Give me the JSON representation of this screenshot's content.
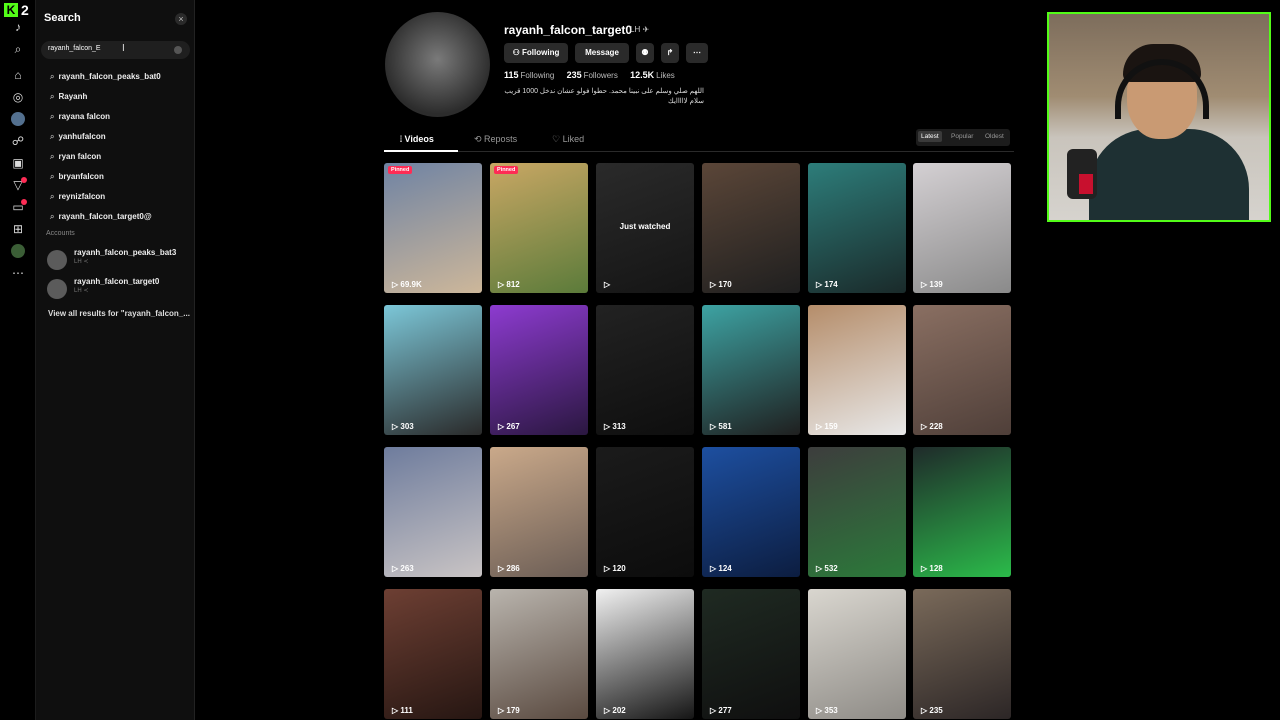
{
  "rail": {
    "brand_letter": "K",
    "viewer_count": "2",
    "icons": [
      "tiktok-logo-icon",
      "search-icon",
      "home-icon",
      "explore-icon",
      "live-icon",
      "following-icon",
      "upload-icon",
      "activity-icon",
      "messages-icon",
      "add-icon",
      "profile-icon",
      "more-icon"
    ]
  },
  "search": {
    "title": "Search",
    "close_label": "×",
    "query": "rayanh_falcon_E",
    "suggestions": [
      "rayanh_falcon_peaks_bat0",
      "Rayanh",
      "rayana falcon",
      "yanhufalcon",
      "ryan falcon",
      "bryanfalcon",
      "reynizfalcon",
      "rayanh_falcon_target0@"
    ],
    "accounts_heading": "Accounts",
    "accounts": [
      {
        "name": "rayanh_falcon_peaks_bat3",
        "sub": "LH ≺"
      },
      {
        "name": "rayanh_falcon_target0",
        "sub": "LH ≺"
      }
    ],
    "view_all": "View all results for \"rayanh_falcon_..."
  },
  "profile": {
    "username": "rayanh_falcon_target0",
    "badge": "LH ✈",
    "buttons": {
      "following": "Following",
      "message": "Message"
    },
    "stats": {
      "following": "115",
      "following_label": "Following",
      "followers": "235",
      "followers_label": "Followers",
      "likes": "12.5K",
      "likes_label": "Likes"
    },
    "bio": "اللهم صلي وسلم على نبينا محمد. حطوا فولو عشان ندخل 1000 قريب سلام لااااايك"
  },
  "tabs": {
    "videos": "Videos",
    "reposts": "Reposts",
    "liked": "Liked"
  },
  "sort": {
    "latest": "Latest",
    "popular": "Popular",
    "oldest": "Oldest"
  },
  "videos": [
    {
      "views": "69.9K",
      "pinned": "Pinned",
      "bg": "#6f83a3",
      "bg2": "#cdb79a"
    },
    {
      "views": "812",
      "pinned": "Pinned",
      "bg": "#c9a764",
      "bg2": "#5b7b3a"
    },
    {
      "views": "",
      "overlay": "Just watched",
      "bg": "#2a2a2a",
      "bg2": "#151515"
    },
    {
      "views": "170",
      "bg": "#5b4638",
      "bg2": "#1f1f1f"
    },
    {
      "views": "174",
      "bg": "#2d7d7a",
      "bg2": "#1a2a2a"
    },
    {
      "views": "139",
      "bg": "#d4d0d3",
      "bg2": "#8a8a8a"
    },
    {
      "views": "303",
      "bg": "#7cc7d8",
      "bg2": "#2a2a2a"
    },
    {
      "views": "267",
      "bg": "#8d3bd0",
      "bg2": "#2a1740"
    },
    {
      "views": "313",
      "bg": "#222",
      "bg2": "#0e0e0e"
    },
    {
      "views": "581",
      "bg": "#3da3a3",
      "bg2": "#1f1f1f"
    },
    {
      "views": "159",
      "bg": "#b58d6a",
      "bg2": "#e8e8e8"
    },
    {
      "views": "228",
      "bg": "#8a6f62",
      "bg2": "#4f3f39"
    },
    {
      "views": "263",
      "bg": "#6e7c9d",
      "bg2": "#c9c4c4"
    },
    {
      "views": "286",
      "bg": "#caa98a",
      "bg2": "#6b5d55"
    },
    {
      "views": "120",
      "bg": "#1b1b1b",
      "bg2": "#0c0c0c"
    },
    {
      "views": "124",
      "bg": "#1d4fa0",
      "bg2": "#0c1d40"
    },
    {
      "views": "532",
      "bg": "#3d3d3d",
      "bg2": "#2b7a3a"
    },
    {
      "views": "128",
      "bg": "#1f2a2a",
      "bg2": "#2bbb4a"
    },
    {
      "views": "111",
      "bg": "#6d3f33",
      "bg2": "#261612"
    },
    {
      "views": "179",
      "bg": "#b9b4ad",
      "bg2": "#5a4a40"
    },
    {
      "views": "202",
      "bg": "#f1f1f1",
      "bg2": "#151515"
    },
    {
      "views": "277",
      "bg": "#1f2a22",
      "bg2": "#0f0f0f"
    },
    {
      "views": "353",
      "bg": "#d9d6cf",
      "bg2": "#8e8b86"
    },
    {
      "views": "235",
      "bg": "#7a6a5a",
      "bg2": "#2c2626"
    }
  ],
  "accent": "#53fc18",
  "brand_red": "#fe2c55"
}
